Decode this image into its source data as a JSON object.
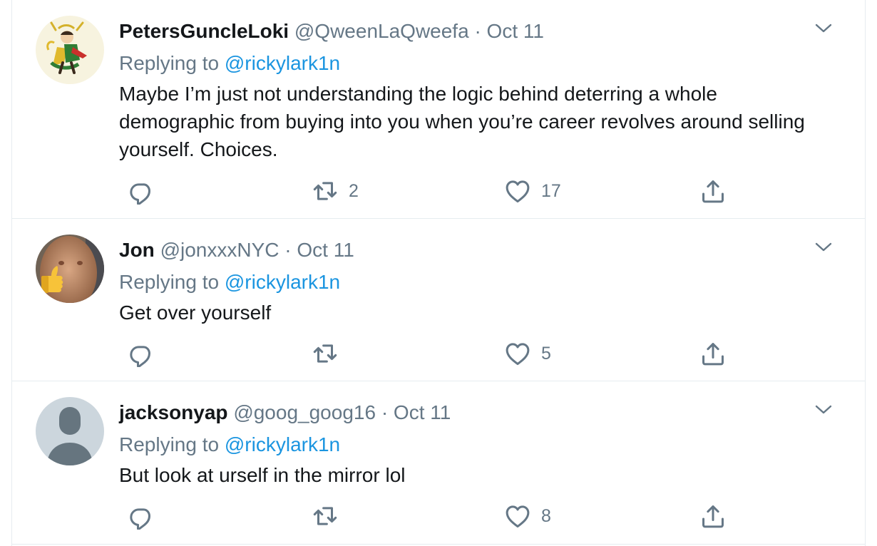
{
  "tweets": [
    {
      "display_name": "PetersGuncleLoki",
      "handle": "@QweenLaQweefa",
      "separator": "·",
      "date": "Oct 11",
      "replying_prefix": "Replying to",
      "replying_to": "@rickylark1n",
      "text": "Maybe I’m just not understanding the logic behind deterring a whole demographic from buying into you when you’re career revolves around selling yourself. Choices.",
      "retweets": "2",
      "likes": "17",
      "avatar": "cartoon-character-avatar"
    },
    {
      "display_name": "Jon",
      "handle": "@jonxxxNYC",
      "separator": "·",
      "date": "Oct 11",
      "replying_prefix": "Replying to",
      "replying_to": "@rickylark1n",
      "text": "Get over yourself",
      "retweets": "",
      "likes": "5",
      "avatar": "photo-avatar-with-thumbs-up"
    },
    {
      "display_name": "jacksonyap",
      "handle": "@goog_goog16",
      "separator": "·",
      "date": "Oct 11",
      "replying_prefix": "Replying to",
      "replying_to": "@rickylark1n",
      "text": "But look at urself in the mirror lol",
      "retweets": "",
      "likes": "8",
      "avatar": "default-avatar"
    }
  ],
  "icons": [
    "chevron-down-icon",
    "reply-icon",
    "retweet-icon",
    "like-icon",
    "share-icon"
  ],
  "colors": {
    "text": "#14171a",
    "muted": "#657786",
    "link": "#1b95e0",
    "border": "#e6ecf0"
  }
}
